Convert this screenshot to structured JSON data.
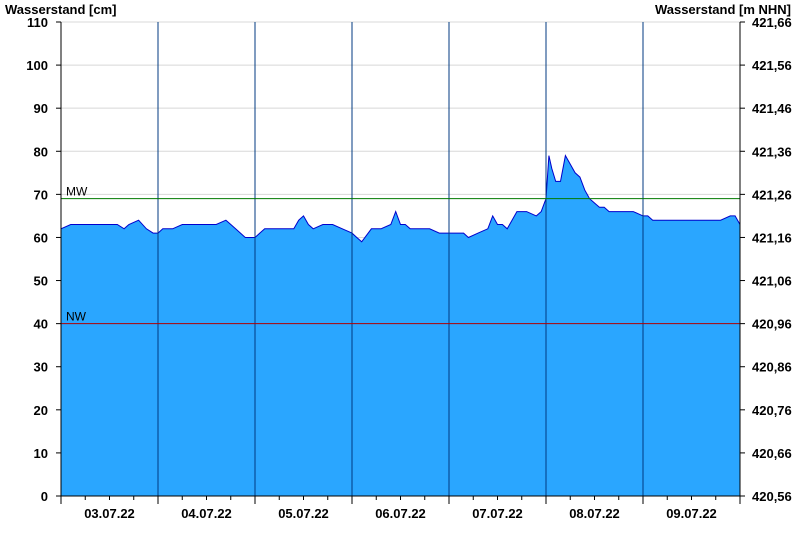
{
  "chart_data": {
    "type": "area",
    "title": "",
    "ylabel_left": "Wasserstand [cm]",
    "ylabel_right": "Wasserstand [m NHN]",
    "ylim": [
      0,
      110
    ],
    "yticks_left": [
      0,
      10,
      20,
      30,
      40,
      50,
      60,
      70,
      80,
      90,
      100,
      110
    ],
    "yticks_left_labels": [
      "0",
      "10",
      "20",
      "30",
      "40",
      "50",
      "60",
      "70",
      "80",
      "90",
      "100",
      "110"
    ],
    "yticks_right_labels": [
      "420,56",
      "420,66",
      "420,76",
      "420,86",
      "420,96",
      "421,06",
      "421,16",
      "421,26",
      "421,36",
      "421,46",
      "421,56",
      "421,66"
    ],
    "xlim_days": [
      0,
      7
    ],
    "xtick_labels": [
      "03.07.22",
      "04.07.22",
      "05.07.22",
      "06.07.22",
      "07.07.22",
      "08.07.22",
      "09.07.22"
    ],
    "grid": true,
    "reference_lines": [
      {
        "label": "MW",
        "value": 69,
        "color": "#007a00"
      },
      {
        "label": "NW",
        "value": 40,
        "color": "#b00000"
      }
    ],
    "colors": {
      "fill": "#2aa6ff",
      "line": "#0000cc",
      "grid": "#d8d8d8",
      "day_divider": "#003a80"
    },
    "series": [
      {
        "x": [
          0,
          0.1,
          0.2,
          0.3,
          0.4,
          0.5,
          0.58,
          0.65,
          0.7,
          0.8,
          0.88,
          0.95,
          1.0,
          1.05,
          1.15,
          1.25,
          1.3,
          1.4,
          1.5,
          1.6,
          1.7,
          1.75,
          1.8,
          1.9,
          2.0,
          2.05,
          2.1,
          2.2,
          2.3,
          2.4,
          2.45,
          2.5,
          2.55,
          2.6,
          2.7,
          2.8,
          2.9,
          3.0,
          3.05,
          3.1,
          3.2,
          3.3,
          3.4,
          3.45,
          3.5,
          3.55,
          3.6,
          3.7,
          3.8,
          3.9,
          4.0,
          4.05,
          4.15,
          4.2,
          4.3,
          4.4,
          4.45,
          4.5,
          4.55,
          4.6,
          4.7,
          4.8,
          4.9,
          4.95,
          5.0,
          5.03,
          5.06,
          5.1,
          5.15,
          5.2,
          5.25,
          5.3,
          5.35,
          5.4,
          5.45,
          5.5,
          5.55,
          5.6,
          5.65,
          5.7,
          5.8,
          5.9,
          6.0,
          6.05,
          6.1,
          6.2,
          6.3,
          6.4,
          6.5,
          6.6,
          6.7,
          6.8,
          6.9,
          6.95,
          7.0
        ],
        "y": [
          62,
          63,
          63,
          63,
          63,
          63,
          63,
          62,
          63,
          64,
          62,
          61,
          61,
          62,
          62,
          63,
          63,
          63,
          63,
          63,
          64,
          63,
          62,
          60,
          60,
          61,
          62,
          62,
          62,
          62,
          64,
          65,
          63,
          62,
          63,
          63,
          62,
          61,
          60,
          59,
          62,
          62,
          63,
          66,
          63,
          63,
          62,
          62,
          62,
          61,
          61,
          61,
          61,
          60,
          61,
          62,
          65,
          63,
          63,
          62,
          66,
          66,
          65,
          66,
          69,
          79,
          76,
          73,
          73,
          79,
          77,
          75,
          74,
          71,
          69,
          68,
          67,
          67,
          66,
          66,
          66,
          66,
          65,
          65,
          64,
          64,
          64,
          64,
          64,
          64,
          64,
          64,
          65,
          65,
          63
        ]
      }
    ]
  }
}
